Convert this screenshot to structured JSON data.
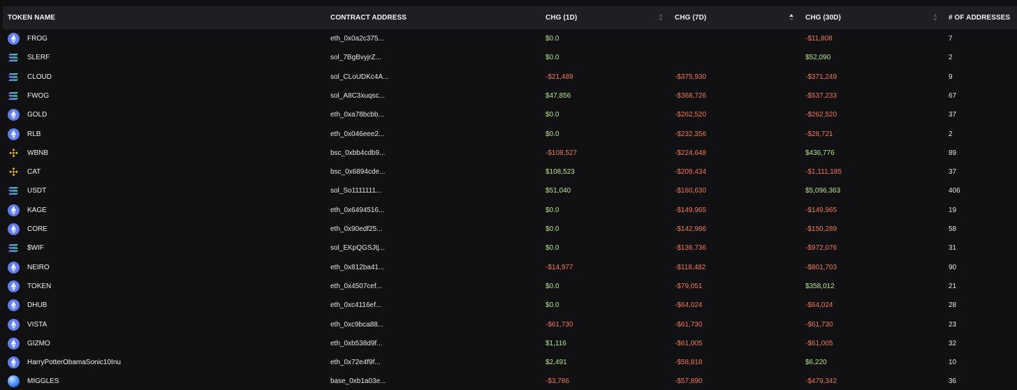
{
  "columns": {
    "token_name": "TOKEN NAME",
    "contract_address": "CONTRACT ADDRESS",
    "chg_1d": "CHG (1D)",
    "chg_7d": "CHG (7D)",
    "chg_30d": "CHG (30D)",
    "num_addresses": "# OF ADDRESSES"
  },
  "sort": {
    "active_column": "chg_7d",
    "direction": "asc"
  },
  "rows": [
    {
      "name": "FROG",
      "chain": "eth",
      "address": "eth_0x0a2c375...",
      "chg_1d": "$0.0",
      "chg_7d": "",
      "chg_30d": "-$11,808",
      "addresses": "7"
    },
    {
      "name": "SLERF",
      "chain": "sol",
      "address": "sol_7BgBvyjrZ...",
      "chg_1d": "$0.0",
      "chg_7d": "",
      "chg_30d": "$52,090",
      "addresses": "2"
    },
    {
      "name": "CLOUD",
      "chain": "sol",
      "address": "sol_CLoUDKc4A...",
      "chg_1d": "-$21,489",
      "chg_7d": "-$375,930",
      "chg_30d": "-$371,249",
      "addresses": "9"
    },
    {
      "name": "FWOG",
      "chain": "sol",
      "address": "sol_A8C3xuqsc...",
      "chg_1d": "$47,856",
      "chg_7d": "-$368,726",
      "chg_30d": "-$537,233",
      "addresses": "67"
    },
    {
      "name": "GOLD",
      "chain": "eth",
      "address": "eth_0xa78bcbb...",
      "chg_1d": "$0.0",
      "chg_7d": "-$262,520",
      "chg_30d": "-$262,520",
      "addresses": "37"
    },
    {
      "name": "RLB",
      "chain": "eth",
      "address": "eth_0x046eee2...",
      "chg_1d": "$0.0",
      "chg_7d": "-$232,356",
      "chg_30d": "-$28,721",
      "addresses": "2"
    },
    {
      "name": "WBNB",
      "chain": "bsc",
      "address": "bsc_0xbb4cdb9...",
      "chg_1d": "-$108,527",
      "chg_7d": "-$224,648",
      "chg_30d": "$436,776",
      "addresses": "89"
    },
    {
      "name": "CAT",
      "chain": "bsc",
      "address": "bsc_0x6894cde...",
      "chg_1d": "$108,523",
      "chg_7d": "-$209,434",
      "chg_30d": "-$1,111,185",
      "addresses": "37"
    },
    {
      "name": "USDT",
      "chain": "sol",
      "address": "sol_So1111111...",
      "chg_1d": "$51,040",
      "chg_7d": "-$160,630",
      "chg_30d": "$5,096,363",
      "addresses": "406"
    },
    {
      "name": "KAGE",
      "chain": "eth",
      "address": "eth_0x6494516...",
      "chg_1d": "$0.0",
      "chg_7d": "-$149,965",
      "chg_30d": "-$149,965",
      "addresses": "19"
    },
    {
      "name": "CORE",
      "chain": "eth",
      "address": "eth_0x90edf25...",
      "chg_1d": "$0.0",
      "chg_7d": "-$142,986",
      "chg_30d": "-$150,289",
      "addresses": "58"
    },
    {
      "name": "$WIF",
      "chain": "sol",
      "address": "sol_EKpQGSJtj...",
      "chg_1d": "$0.0",
      "chg_7d": "-$136,736",
      "chg_30d": "-$972,076",
      "addresses": "31"
    },
    {
      "name": "NEIRO",
      "chain": "eth",
      "address": "eth_0x812ba41...",
      "chg_1d": "-$14,977",
      "chg_7d": "-$118,482",
      "chg_30d": "-$801,703",
      "addresses": "90"
    },
    {
      "name": "TOKEN",
      "chain": "eth",
      "address": "eth_0x4507cef...",
      "chg_1d": "$0.0",
      "chg_7d": "-$79,051",
      "chg_30d": "$358,012",
      "addresses": "21"
    },
    {
      "name": "DHUB",
      "chain": "eth",
      "address": "eth_0xc4116ef...",
      "chg_1d": "$0.0",
      "chg_7d": "-$64,024",
      "chg_30d": "-$64,024",
      "addresses": "28"
    },
    {
      "name": "VISTA",
      "chain": "eth",
      "address": "eth_0xc9bca88...",
      "chg_1d": "-$61,730",
      "chg_7d": "-$61,730",
      "chg_30d": "-$61,730",
      "addresses": "23"
    },
    {
      "name": "GIZMO",
      "chain": "eth",
      "address": "eth_0xb538d9f...",
      "chg_1d": "$1,116",
      "chg_7d": "-$61,005",
      "chg_30d": "-$61,005",
      "addresses": "32"
    },
    {
      "name": "HarryPotterObamaSonic10Inu",
      "chain": "eth",
      "address": "eth_0x72e4f9f...",
      "chg_1d": "$2,491",
      "chg_7d": "-$58,818",
      "chg_30d": "$6,220",
      "addresses": "10"
    },
    {
      "name": "MIGGLES",
      "chain": "base",
      "address": "base_0xb1a03e...",
      "chg_1d": "-$3,786",
      "chg_7d": "-$57,890",
      "chg_30d": "-$479,342",
      "addresses": "36"
    }
  ],
  "colors": {
    "positive": "#b9e58e",
    "negative": "#f0795a",
    "header_bg": "#1f1f23",
    "page_bg": "#111113"
  },
  "icons": {
    "eth": "ethereum-icon",
    "sol": "solana-icon",
    "bsc": "bnb-icon",
    "base": "base-icon"
  }
}
